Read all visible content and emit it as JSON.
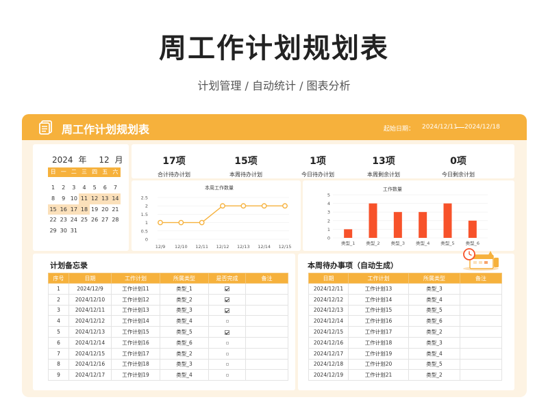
{
  "hero": {
    "title": "周工作计划规划表",
    "subtitle": "计划管理 / 自动统计 / 图表分析"
  },
  "header": {
    "title": "周工作计划规划表",
    "start_label": "起始日期：",
    "start_date": "2024/12/11",
    "end_date": "2024/12/18",
    "bar_color": "#f6b13c"
  },
  "calendar": {
    "year": "2024",
    "year_unit": "年",
    "month": "12",
    "month_unit": "月",
    "weekdays": [
      "日",
      "一",
      "二",
      "三",
      "四",
      "五",
      "六"
    ],
    "weeks": [
      [
        "",
        "",
        "",
        "",
        "",
        "",
        ""
      ],
      [
        "",
        "",
        "",
        "",
        "",
        "",
        ""
      ],
      [
        "1",
        "2",
        "3",
        "4",
        "5",
        "6",
        "7"
      ],
      [
        "8",
        "9",
        "10",
        "11",
        "12",
        "13",
        "14"
      ],
      [
        "15",
        "16",
        "17",
        "18",
        "19",
        "20",
        "21"
      ],
      [
        "22",
        "23",
        "24",
        "25",
        "26",
        "27",
        "28"
      ],
      [
        "29",
        "30",
        "31",
        "",
        "",
        "",
        ""
      ]
    ],
    "highlighted_days": [
      "11",
      "12",
      "13",
      "14",
      "15",
      "16",
      "17",
      "18"
    ]
  },
  "stats": [
    {
      "value": "17项",
      "label": "合计待办计划"
    },
    {
      "value": "15项",
      "label": "本周待办计划"
    },
    {
      "value": "1项",
      "label": "今日待办计划"
    },
    {
      "value": "13项",
      "label": "本周剩余计划"
    },
    {
      "value": "0项",
      "label": "今日剩余计划"
    }
  ],
  "chart_data": [
    {
      "type": "line",
      "title": "本周工作数量",
      "categories": [
        "12/9",
        "12/10",
        "12/11",
        "12/12",
        "12/13",
        "12/14",
        "12/15"
      ],
      "values": [
        1,
        1,
        1,
        2,
        2,
        2,
        2
      ],
      "ylim": [
        0,
        2.5
      ],
      "yticks": [
        "0",
        "0.5",
        "1",
        "1.5",
        "2",
        "2.5"
      ],
      "color": "#f6b13c",
      "grid": true
    },
    {
      "type": "bar",
      "title": "工作数量",
      "categories": [
        "类型_1",
        "类型_2",
        "类型_3",
        "类型_4",
        "类型_5",
        "类型_6"
      ],
      "values": [
        1,
        4,
        3,
        3,
        4,
        2
      ],
      "ylim": [
        0,
        5
      ],
      "yticks": [
        "0",
        "1",
        "2",
        "3",
        "4",
        "5"
      ],
      "color": "#f7522a",
      "grid": true
    }
  ],
  "memo": {
    "title": "计划备忘录",
    "columns": [
      "序号",
      "日期",
      "工作计划",
      "所属类型",
      "是否完成",
      "备注"
    ],
    "rows": [
      {
        "no": "1",
        "date": "2024/12/9",
        "plan": "工作计划11",
        "type": "类型_1",
        "done": true
      },
      {
        "no": "2",
        "date": "2024/12/10",
        "plan": "工作计划12",
        "type": "类型_2",
        "done": true
      },
      {
        "no": "3",
        "date": "2024/12/11",
        "plan": "工作计划13",
        "type": "类型_3",
        "done": true
      },
      {
        "no": "4",
        "date": "2024/12/12",
        "plan": "工作计划14",
        "type": "类型_4",
        "done": false
      },
      {
        "no": "5",
        "date": "2024/12/13",
        "plan": "工作计划15",
        "type": "类型_5",
        "done": true
      },
      {
        "no": "6",
        "date": "2024/12/14",
        "plan": "工作计划16",
        "type": "类型_6",
        "done": false
      },
      {
        "no": "7",
        "date": "2024/12/15",
        "plan": "工作计划17",
        "type": "类型_2",
        "done": false
      },
      {
        "no": "8",
        "date": "2024/12/16",
        "plan": "工作计划18",
        "type": "类型_3",
        "done": false
      },
      {
        "no": "9",
        "date": "2024/12/17",
        "plan": "工作计划19",
        "type": "类型_4",
        "done": false
      }
    ]
  },
  "todo": {
    "title": "本周待办事项（自动生成）",
    "columns": [
      "日期",
      "工作计划",
      "所属类型",
      "备注"
    ],
    "rows": [
      {
        "date": "2024/12/11",
        "plan": "工作计划13",
        "type": "类型_3"
      },
      {
        "date": "2024/12/12",
        "plan": "工作计划14",
        "type": "类型_4"
      },
      {
        "date": "2024/12/13",
        "plan": "工作计划15",
        "type": "类型_5"
      },
      {
        "date": "2024/12/14",
        "plan": "工作计划16",
        "type": "类型_6"
      },
      {
        "date": "2024/12/15",
        "plan": "工作计划17",
        "type": "类型_2"
      },
      {
        "date": "2024/12/16",
        "plan": "工作计划18",
        "type": "类型_3"
      },
      {
        "date": "2024/12/17",
        "plan": "工作计划19",
        "type": "类型_4"
      },
      {
        "date": "2024/12/18",
        "plan": "工作计划20",
        "type": "类型_5"
      },
      {
        "date": "2024/12/19",
        "plan": "工作计划21",
        "type": "类型_2"
      }
    ]
  },
  "colors": {
    "accent": "#f6b13c",
    "bar": "#f7522a",
    "card_bg": "#fdf3e3",
    "highlight": "#fbe0ba"
  }
}
